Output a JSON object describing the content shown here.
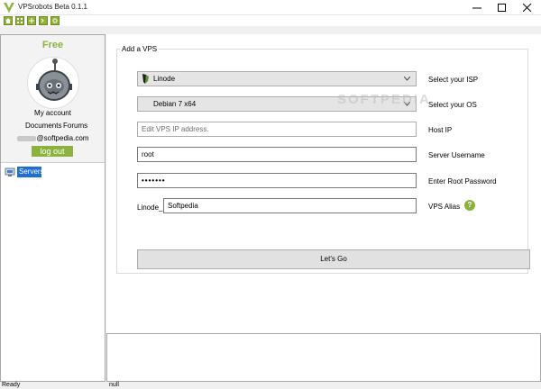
{
  "window": {
    "title": "VPSrobots Beta 0.1.1"
  },
  "toolbar": {
    "icons": [
      "home-icon",
      "grid-icon",
      "network-icon",
      "terminal-icon",
      "settings-icon"
    ]
  },
  "account": {
    "plan": "Free",
    "my_account": "My account",
    "documents": "Documents",
    "forums": "Forums",
    "email_domain": "@softpedia.com",
    "logout": "log out"
  },
  "tree": {
    "servers": "Servers"
  },
  "form": {
    "group_title": "Add a VPS",
    "isp": {
      "value": "Linode",
      "label": "Select your ISP"
    },
    "os": {
      "value": "Debian 7 x64",
      "label": "Select your OS"
    },
    "host_ip": {
      "placeholder": "Edit VPS IP address.",
      "label": "Host IP"
    },
    "username": {
      "value": "root",
      "label": "Server Username"
    },
    "password": {
      "value": "•••••••",
      "label": "Enter Root Password"
    },
    "alias": {
      "prefix": "Linode_",
      "value": "Softpedia",
      "label": "VPS Alias"
    },
    "help": "?",
    "submit": "Let's Go"
  },
  "watermark": "SOFTPEDIA",
  "status": {
    "left": "Ready",
    "right": "null"
  },
  "colors": {
    "accent": "#8cb23e",
    "selection": "#1f6fd1"
  }
}
